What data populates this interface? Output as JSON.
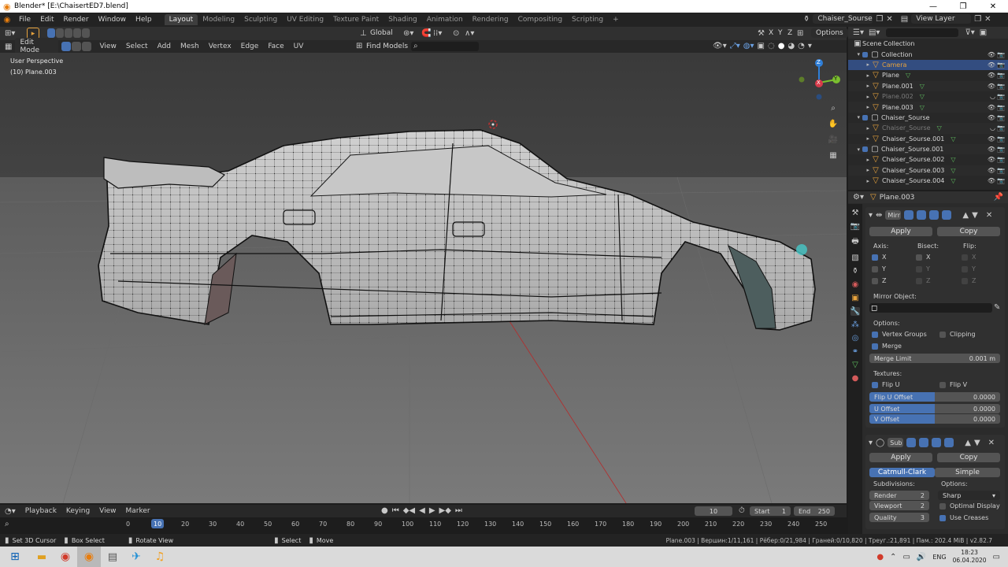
{
  "window": {
    "title": "Blender* [E:\\ChaisertED7.blend]",
    "minimize": "—",
    "maximize": "❐",
    "close": "✕"
  },
  "menu": {
    "items": [
      "File",
      "Edit",
      "Render",
      "Window",
      "Help"
    ]
  },
  "workspaces": {
    "tabs": [
      "Layout",
      "Modeling",
      "Sculpting",
      "UV Editing",
      "Texture Paint",
      "Shading",
      "Animation",
      "Rendering",
      "Compositing",
      "Scripting"
    ],
    "active": "Layout",
    "add": "+"
  },
  "scene": {
    "name": "Chaiser_Sourse",
    "view_layer": "View Layer"
  },
  "tool_header": {
    "orientation": "Global",
    "xyz": [
      "X",
      "Y",
      "Z"
    ],
    "options": "Options"
  },
  "viewport_header": {
    "mode": "Edit Mode",
    "menus": [
      "View",
      "Select",
      "Add",
      "Mesh",
      "Vertex",
      "Edge",
      "Face",
      "UV"
    ],
    "find": "Find Models"
  },
  "viewport": {
    "perspective": "User Perspective",
    "object_info": "(10) Plane.003",
    "gizmo": {
      "x": "X",
      "y": "Y",
      "z": "Z"
    }
  },
  "outliner": {
    "root": "Scene Collection",
    "rows": [
      {
        "label": "Collection",
        "type": "collection",
        "indent": 1,
        "selected": false,
        "dim": false
      },
      {
        "label": "Camera",
        "type": "camera",
        "indent": 2,
        "selected": true,
        "dim": false
      },
      {
        "label": "Plane",
        "type": "mesh",
        "indent": 2,
        "selected": false,
        "dim": false
      },
      {
        "label": "Plane.001",
        "type": "mesh",
        "indent": 2,
        "selected": false,
        "dim": false
      },
      {
        "label": "Plane.002",
        "type": "mesh",
        "indent": 2,
        "selected": false,
        "dim": true
      },
      {
        "label": "Plane.003",
        "type": "mesh",
        "indent": 2,
        "selected": false,
        "dim": false
      },
      {
        "label": "Chaiser_Sourse",
        "type": "collection",
        "indent": 1,
        "selected": false,
        "dim": false
      },
      {
        "label": "Chaiser_Sourse",
        "type": "mesh",
        "indent": 2,
        "selected": false,
        "dim": true
      },
      {
        "label": "Chaiser_Sourse.001",
        "type": "mesh",
        "indent": 2,
        "selected": false,
        "dim": false
      },
      {
        "label": "Chaiser_Sourse.001",
        "type": "collection",
        "indent": 1,
        "selected": false,
        "dim": false
      },
      {
        "label": "Chaiser_Sourse.002",
        "type": "mesh",
        "indent": 2,
        "selected": false,
        "dim": false
      },
      {
        "label": "Chaiser_Sourse.003",
        "type": "mesh",
        "indent": 2,
        "selected": false,
        "dim": false
      },
      {
        "label": "Chaiser_Sourse.004",
        "type": "mesh",
        "indent": 2,
        "selected": false,
        "dim": false
      }
    ]
  },
  "properties": {
    "object": "Plane.003",
    "mirror": {
      "name": "Mirr",
      "apply": "Apply",
      "copy": "Copy",
      "axis_label": "Axis:",
      "bisect_label": "Bisect:",
      "flip_label": "Flip:",
      "axes": [
        "X",
        "Y",
        "Z"
      ],
      "mirror_object": "Mirror Object:",
      "options_label": "Options:",
      "vertex_groups": "Vertex Groups",
      "clipping": "Clipping",
      "merge": "Merge",
      "merge_limit": "Merge Limit",
      "merge_limit_value": "0.001 m",
      "textures_label": "Textures:",
      "flip_u": "Flip U",
      "flip_v": "Flip V",
      "flip_u_offset": "Flip U Offset",
      "flip_u_offset_value": "0.0000",
      "u_offset": "U Offset",
      "u_offset_value": "0.0000",
      "v_offset": "V Offset",
      "v_offset_value": "0.0000"
    },
    "subsurf": {
      "name": "Sub",
      "apply": "Apply",
      "copy": "Copy",
      "catmull": "Catmull-Clark",
      "simple": "Simple",
      "subdivisions_label": "Subdivisions:",
      "options_label": "Options:",
      "render": "Render",
      "render_value": "2",
      "viewport": "Viewport",
      "viewport_value": "2",
      "quality": "Quality",
      "quality_value": "3",
      "sharp": "Sharp",
      "optimal_display": "Optimal Display",
      "use_creases": "Use Creases"
    }
  },
  "timeline": {
    "menus": [
      "Playback",
      "Keying",
      "View",
      "Marker"
    ],
    "current_frame": "10",
    "start_label": "Start",
    "start": "1",
    "end_label": "End",
    "end": "250",
    "ticks": [
      "0",
      "10",
      "20",
      "30",
      "40",
      "50",
      "60",
      "70",
      "80",
      "90",
      "100",
      "110",
      "120",
      "130",
      "140",
      "150",
      "160",
      "170",
      "180",
      "190",
      "200",
      "210",
      "220",
      "230",
      "240",
      "250"
    ]
  },
  "statusbar": {
    "set_cursor": "Set 3D Cursor",
    "box_select": "Box Select",
    "rotate_view": "Rotate View",
    "select": "Select",
    "move": "Move",
    "stats": "Plane.003 | Вершин:1/11,161 | Рёбер:0/21,984 | Граней:0/10,820 | Треуг.:21,891 | Пам.: 202.4 MiB | v2.82.7"
  },
  "taskbar": {
    "lang": "ENG",
    "time": "18:23",
    "date": "06.04.2020"
  },
  "colors": {
    "accent": "#4772b3",
    "selected_row": "#334d80",
    "viewport_bg": "#3d3d3d",
    "floor": "#5e5e5e"
  }
}
